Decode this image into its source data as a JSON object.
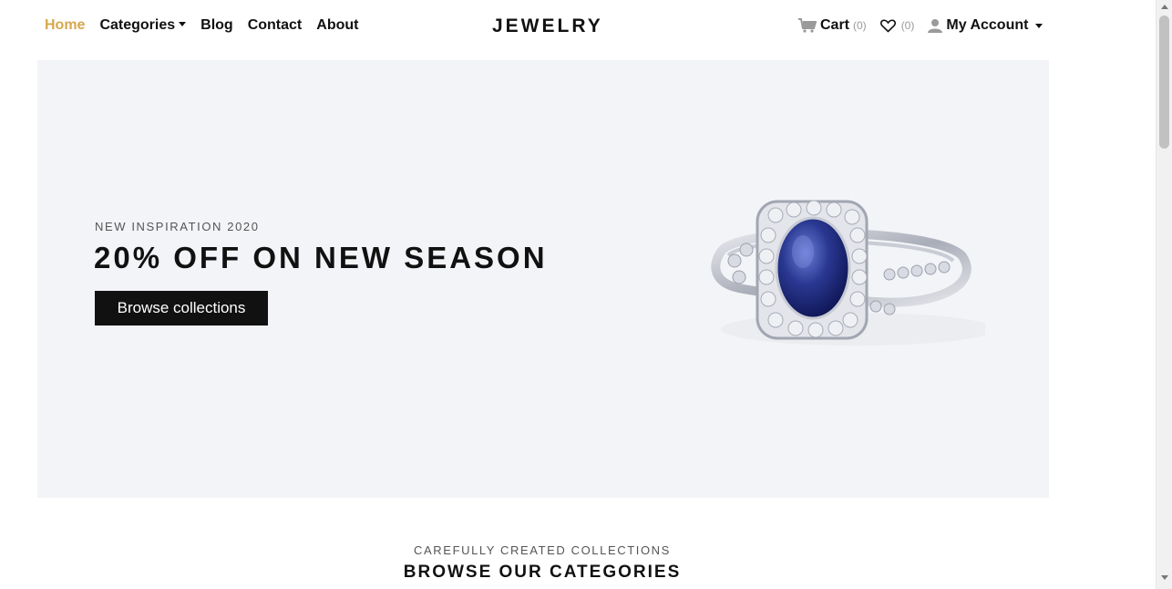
{
  "nav": {
    "home": "Home",
    "categories": "Categories",
    "blog": "Blog",
    "contact": "Contact",
    "about": "About",
    "active_color": "#d6a84e"
  },
  "brand": "JEWELRY",
  "header_right": {
    "cart_label": "Cart",
    "cart_count": "(0)",
    "wishlist_count": "(0)",
    "account_label": "My Account",
    "icons": [
      "cart-icon",
      "heart-icon",
      "user-icon"
    ]
  },
  "hero": {
    "subtitle": "NEW INSPIRATION 2020",
    "title": "20% OFF ON NEW SEASON",
    "button": "Browse collections",
    "image": "sapphire-ring"
  },
  "section": {
    "subtitle": "CAREFULLY CREATED COLLECTIONS",
    "title": "BROWSE OUR CATEGORIES"
  }
}
